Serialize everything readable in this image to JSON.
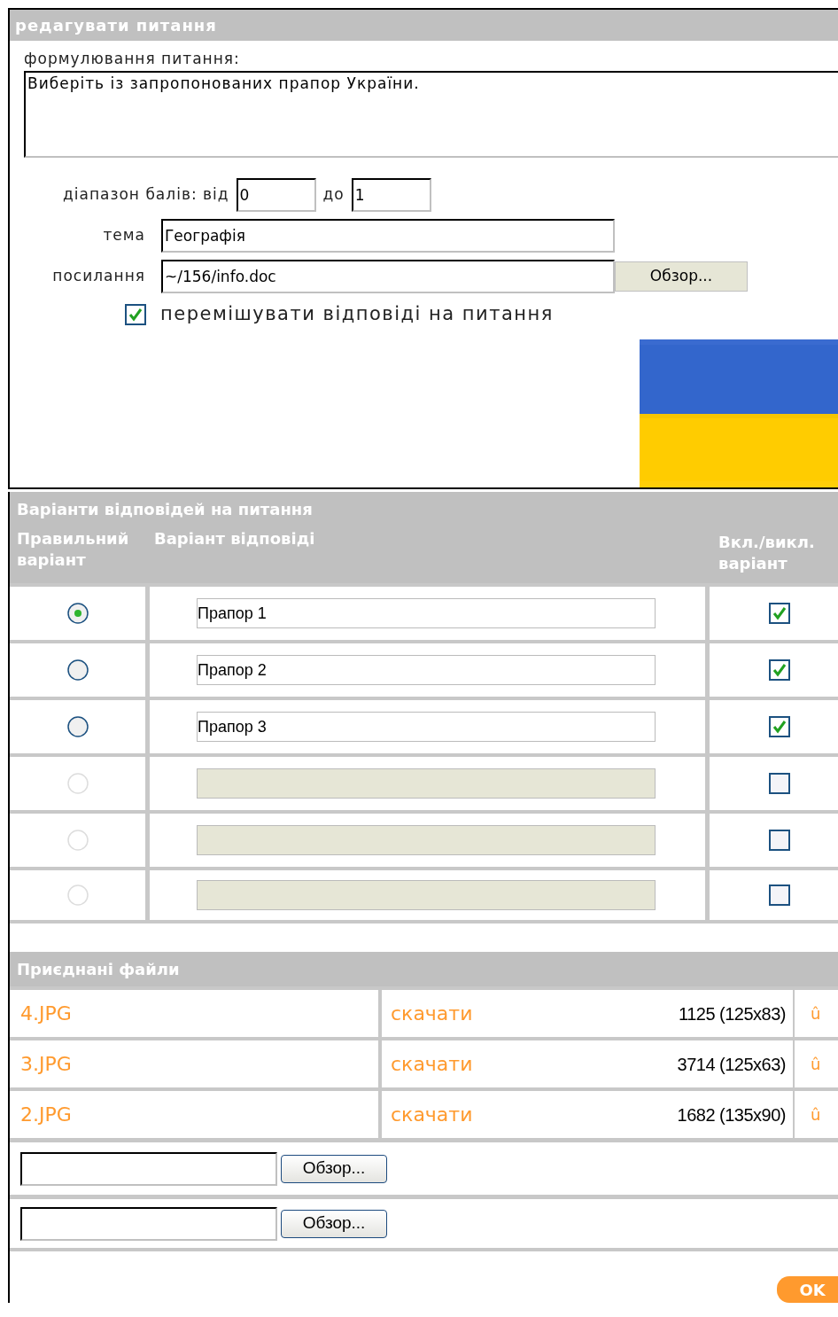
{
  "question_panel": {
    "title": "редагувати питання",
    "wording_label": "формулювання питання:",
    "wording": "Виберіть із запропонованих прапор України.",
    "range_label": "діапазон балів: від",
    "range_from": "0",
    "range_to_label": "до",
    "range_to": "1",
    "topic_label": "тема",
    "topic": "Географія",
    "link_label": "посилання",
    "link": "~/156/info.doc",
    "browse_button": "Обзор...",
    "shuffle": {
      "label": "перемішувати відповіді на питання",
      "checked": true
    }
  },
  "answers_panel": {
    "title": "Варіанти відповідей на питання",
    "columns": [
      "Правильний варіант",
      "Варіант відповіді",
      "Вкл./викл. варіант"
    ],
    "rows": [
      {
        "selected": true,
        "value": "Прапор 1",
        "enabled": true
      },
      {
        "selected": false,
        "value": "Прапор 2",
        "enabled": true
      },
      {
        "selected": false,
        "value": "Прапор 3",
        "enabled": true
      },
      {
        "selected": false,
        "value": "",
        "enabled": false
      },
      {
        "selected": false,
        "value": "",
        "enabled": false
      },
      {
        "selected": false,
        "value": "",
        "enabled": false
      }
    ]
  },
  "files_panel": {
    "title": "Приєднані файли",
    "files": [
      {
        "name": "4.JPG",
        "download": "скачати",
        "size": "1125 (125x83)",
        "delete": "û"
      },
      {
        "name": "3.JPG",
        "download": "скачати",
        "size": "3714 (125x63)",
        "delete": "û"
      },
      {
        "name": "2.JPG",
        "download": "скачати",
        "size": "1682 (135x90)",
        "delete": "û"
      }
    ],
    "uploads": [
      {
        "button": "Обзор..."
      },
      {
        "button": "Обзор..."
      }
    ]
  },
  "ok_button": "OK"
}
